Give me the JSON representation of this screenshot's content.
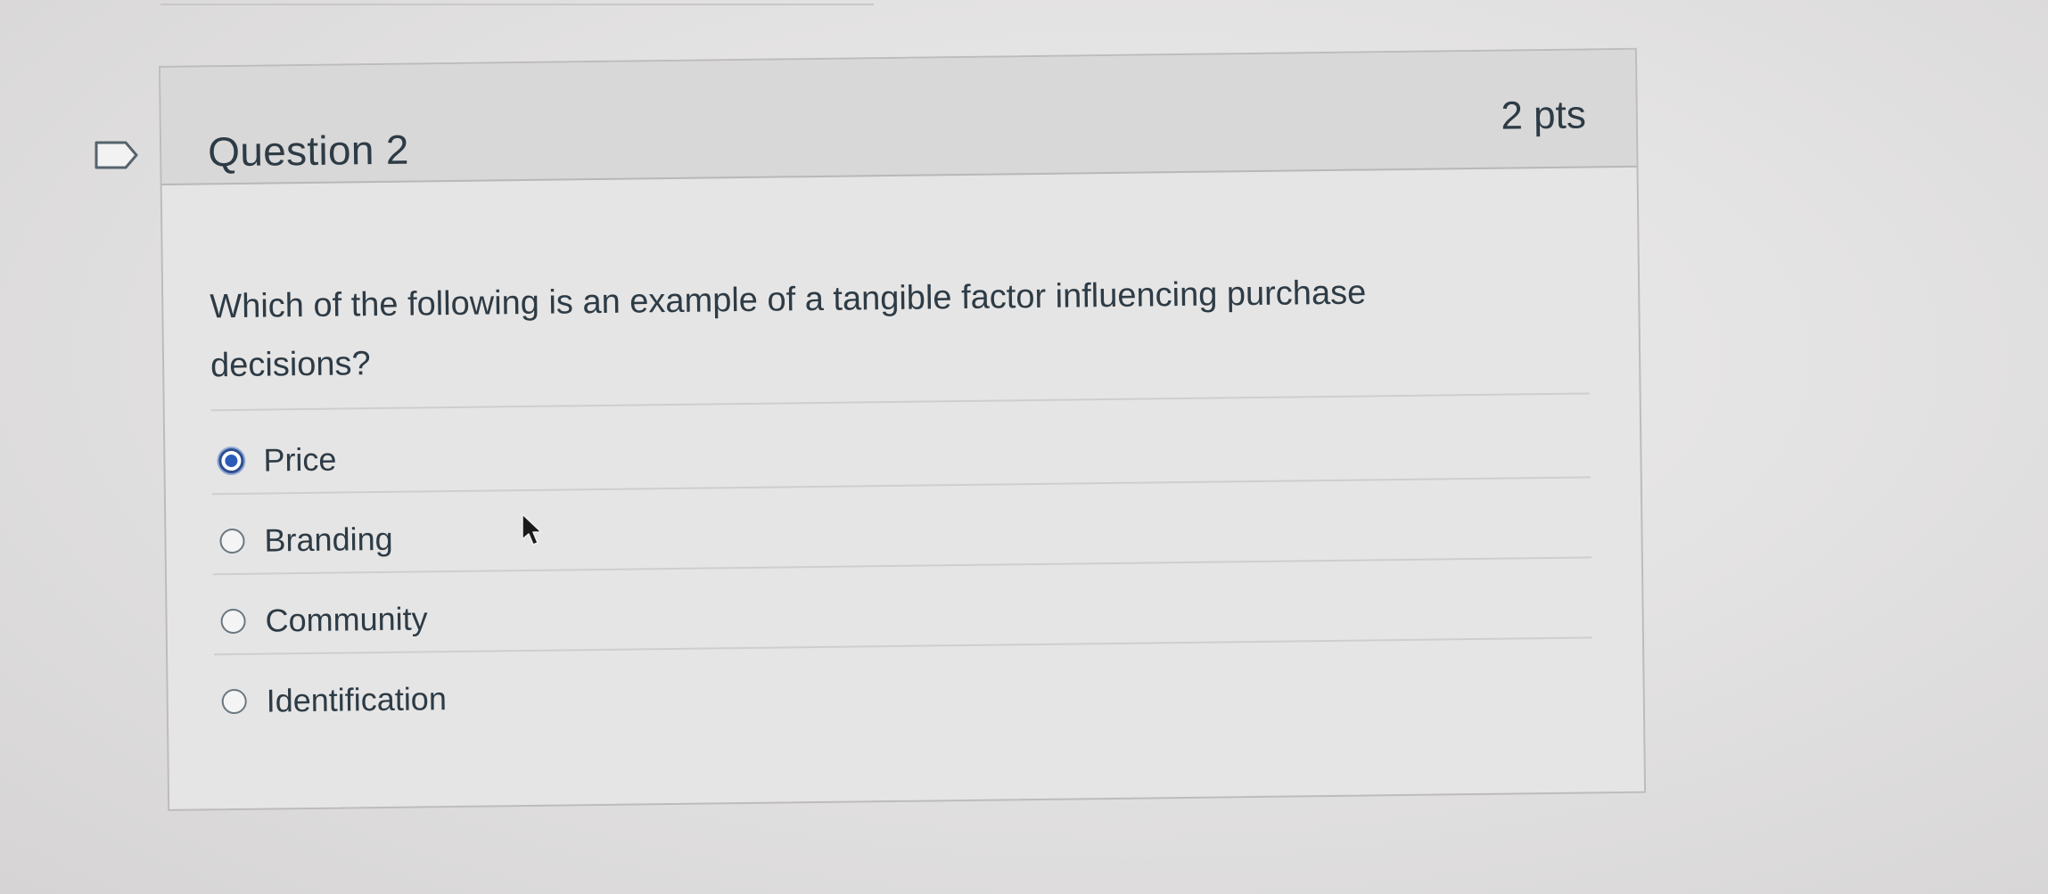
{
  "question": {
    "title": "Question 2",
    "points": "2 pts",
    "text": "Which of the following is an example of a tangible factor influencing purchase decisions?",
    "answers": [
      {
        "label": "Price",
        "selected": true
      },
      {
        "label": "Branding",
        "selected": false
      },
      {
        "label": "Community",
        "selected": false
      },
      {
        "label": "Identification",
        "selected": false
      }
    ]
  },
  "icons": {
    "flag": "bookmark-flag-icon",
    "pointer": "mouse-pointer-icon",
    "radio_selected": "radio-selected-icon",
    "radio_unselected": "radio-unselected-icon"
  },
  "colors": {
    "text": "#2d3b45",
    "header_background": "#d9d8d8",
    "selected_radio": "#2a5bb8"
  }
}
